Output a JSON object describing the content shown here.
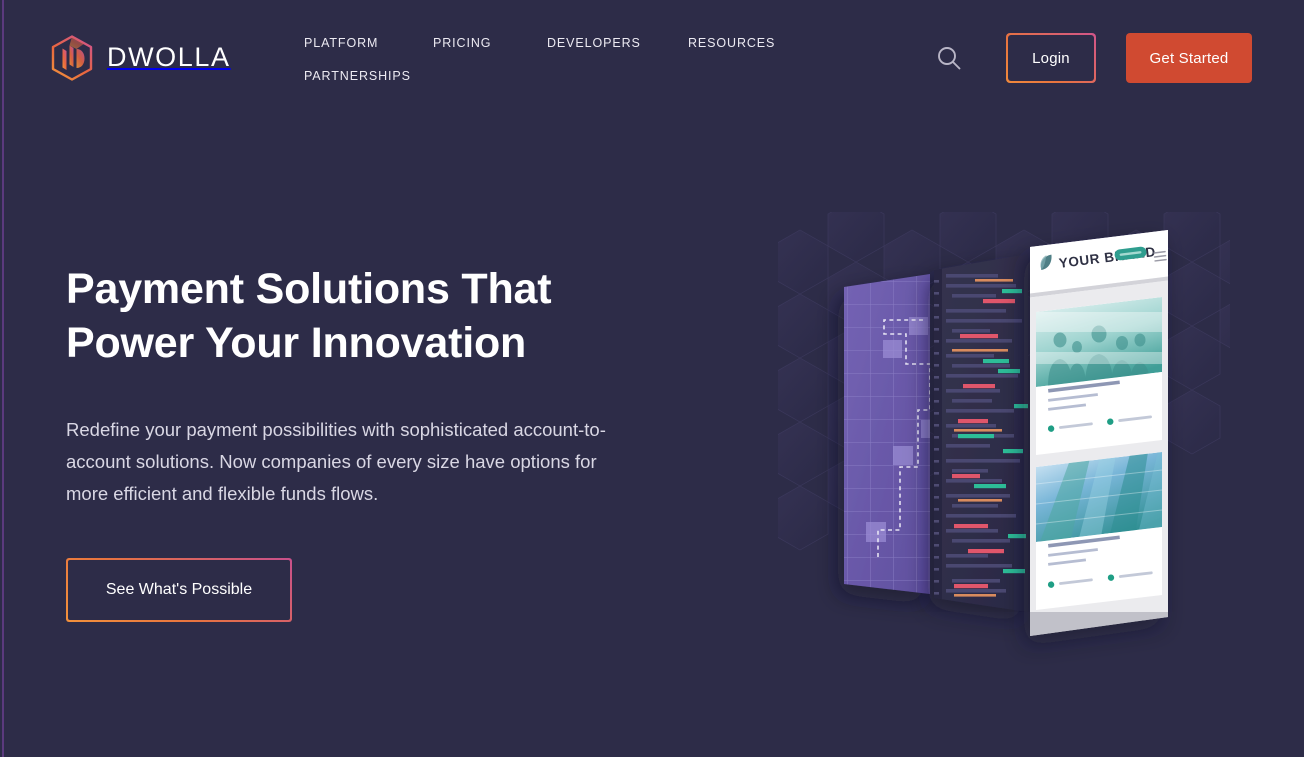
{
  "brand": {
    "name": "DWOLLA",
    "logo_icon": "dwolla-hex-logo",
    "gradient_start": "#f0903c",
    "gradient_end": "#d1558b"
  },
  "nav": {
    "items": [
      {
        "label": "PLATFORM"
      },
      {
        "label": "PRICING"
      },
      {
        "label": "DEVELOPERS"
      },
      {
        "label": "RESOURCES"
      },
      {
        "label": "PARTNERSHIPS"
      }
    ]
  },
  "header_actions": {
    "search_icon": "search-icon",
    "login_label": "Login",
    "get_started_label": "Get Started",
    "get_started_color": "#d04a31"
  },
  "hero": {
    "title_line1": "Payment Solutions That",
    "title_line2": "Power Your Innovation",
    "subtitle": "Redefine your payment possibilities with sophisticated account-to-account solutions. Now companies of every size have options for more efficient and flexible funds flows.",
    "cta_label": "See What's Possible"
  },
  "illustration": {
    "description": "Three layered angled panels: purple grid flow-diagram board, dark code editor, and a white website mockup.",
    "background_color": "#2d2c48",
    "hex_pattern_color": "#343152",
    "panels": [
      {
        "name": "flow-diagram-panel",
        "fill": "#6a5aa8",
        "grid_color": "#8a7bc4",
        "path_style": "dashed-white-staircase"
      },
      {
        "name": "code-editor-panel",
        "fill": "#2f2e4c",
        "gutter_fill": "#262540",
        "syntax_colors": [
          "#e0566b",
          "#2dbd98",
          "#d98b5e",
          "#5a588a"
        ]
      },
      {
        "name": "brand-site-mockup",
        "fill": "#f4f4f6",
        "brand_label": "YOUR BRAND",
        "brand_logo_icon": "leaf-icon",
        "cta_pill_color": "#2f9e8f",
        "menu_icon": "hamburger-icon",
        "cards": [
          {
            "name": "people-photo-card",
            "photo_tint": "#3fa9a0"
          },
          {
            "name": "building-photo-card",
            "photo_tint": "#3f8fbd"
          }
        ]
      }
    ]
  }
}
